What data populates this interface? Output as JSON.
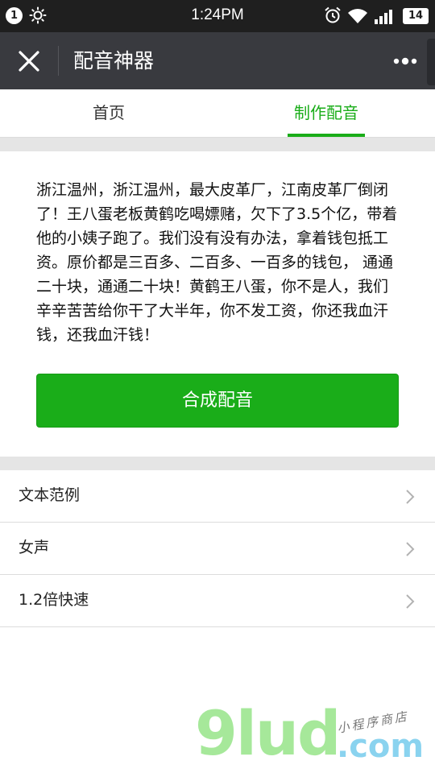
{
  "status_bar": {
    "badge": "1",
    "time": "1:24PM",
    "battery": "14",
    "icons": [
      "brightness-icon",
      "alarm-icon",
      "wifi-icon",
      "signal-icon",
      "battery-icon"
    ]
  },
  "navbar": {
    "title": "配音神器",
    "icons": [
      "close-icon",
      "more-icon"
    ]
  },
  "tabs": [
    {
      "label": "首页",
      "active": false
    },
    {
      "label": "制作配音",
      "active": true
    }
  ],
  "content": {
    "text": "浙江温州，浙江温州，最大皮革厂，江南皮革厂倒闭了！王八蛋老板黄鹤吃喝嫖赌，欠下了3.5个亿，带着他的小姨子跑了。我们没有没有办法，拿着钱包抵工资。原价都是三百多、二百多、一百多的钱包， 通通二十块，通通二十块！黄鹤王八蛋，你不是人，我们辛辛苦苦给你干了大半年，你不发工资，你还我血汗钱，还我血汗钱！",
    "button_label": "合成配音"
  },
  "settings": [
    {
      "label": "文本范例"
    },
    {
      "label": "女声"
    },
    {
      "label": "1.2倍快速"
    }
  ],
  "watermark": {
    "brand": "9lud",
    "domain": ".com",
    "tagline": "小程序商店"
  },
  "colors": {
    "accent": "#1aad19",
    "navbar": "#393a3f",
    "status_bar": "#1f1f1f",
    "separator": "#e5e5e5"
  }
}
